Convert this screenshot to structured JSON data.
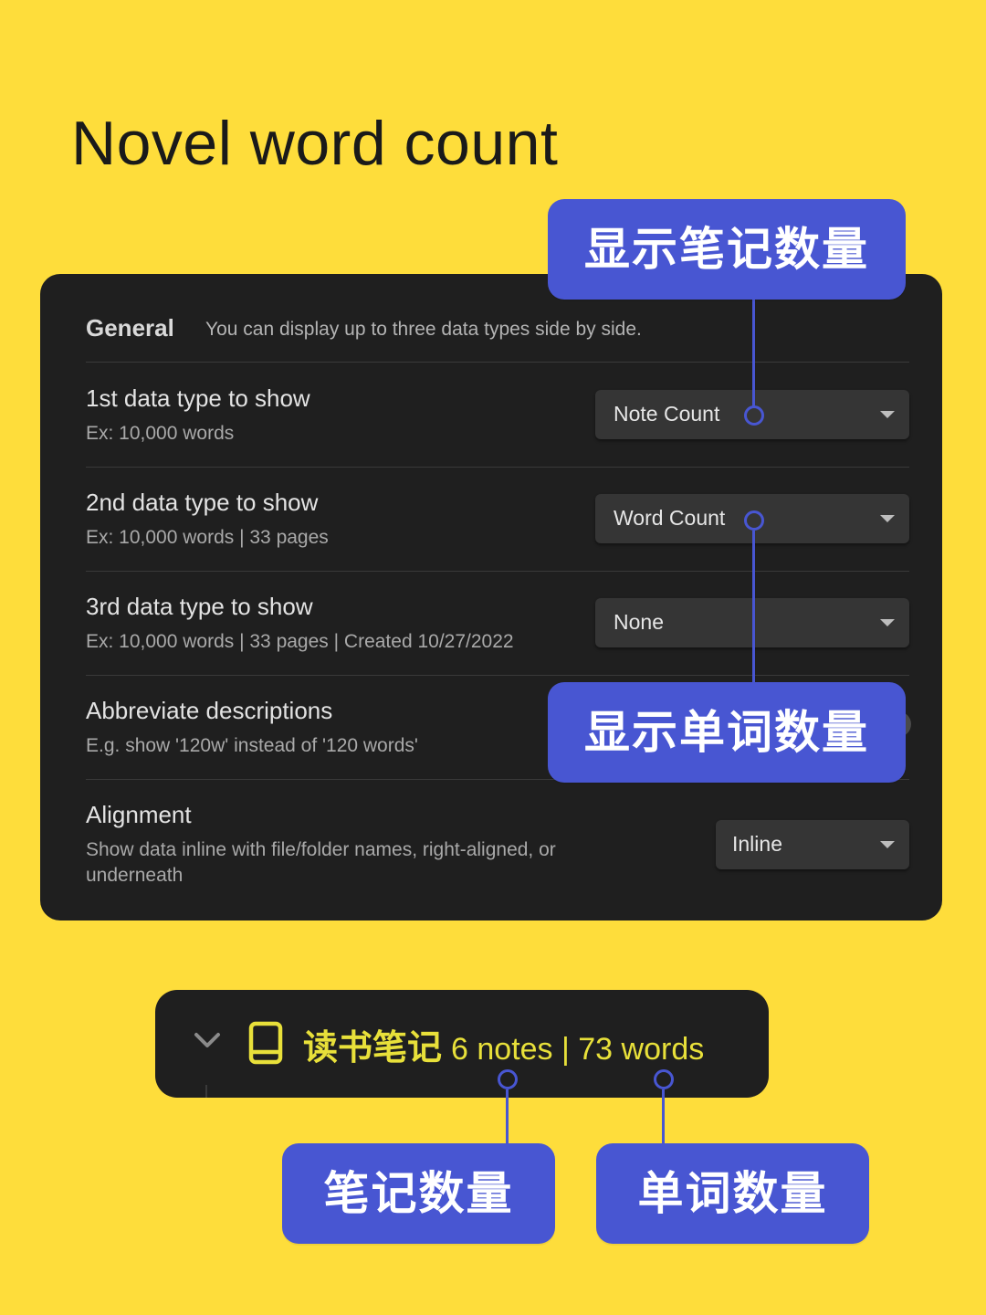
{
  "page_title": "Novel word count",
  "settings_panel": {
    "header_title": "General",
    "header_desc": "You can display up to three data types side by side.",
    "settings": [
      {
        "name": "1st data type to show",
        "desc": "Ex: 10,000 words",
        "value": "Note Count"
      },
      {
        "name": "2nd data type to show",
        "desc": "Ex: 10,000 words | 33 pages",
        "value": "Word Count"
      },
      {
        "name": "3rd data type to show",
        "desc": "Ex: 10,000 words | 33 pages | Created 10/27/2022",
        "value": "None"
      },
      {
        "name": "Abbreviate descriptions",
        "desc": "E.g. show '120w' instead of '120 words'"
      },
      {
        "name": "Alignment",
        "desc_line1": "Show data inline with file/folder names, right-aligned, or",
        "desc_line2": "underneath",
        "value": "Inline"
      }
    ]
  },
  "callouts": {
    "show_note_count": "显示笔记数量",
    "show_word_count": "显示单词数量",
    "note_count": "笔记数量",
    "word_count": "单词数量"
  },
  "folder_row": {
    "name": "读书笔记",
    "stats": "6 notes | 73 words"
  },
  "colors": {
    "background": "#FEDD3B",
    "panel": "#1F1F1F",
    "callout": "#4856D2",
    "folder_text": "#E8E03A"
  },
  "icons": [
    "chevron-down-icon",
    "book-icon",
    "caret-down-icon"
  ]
}
